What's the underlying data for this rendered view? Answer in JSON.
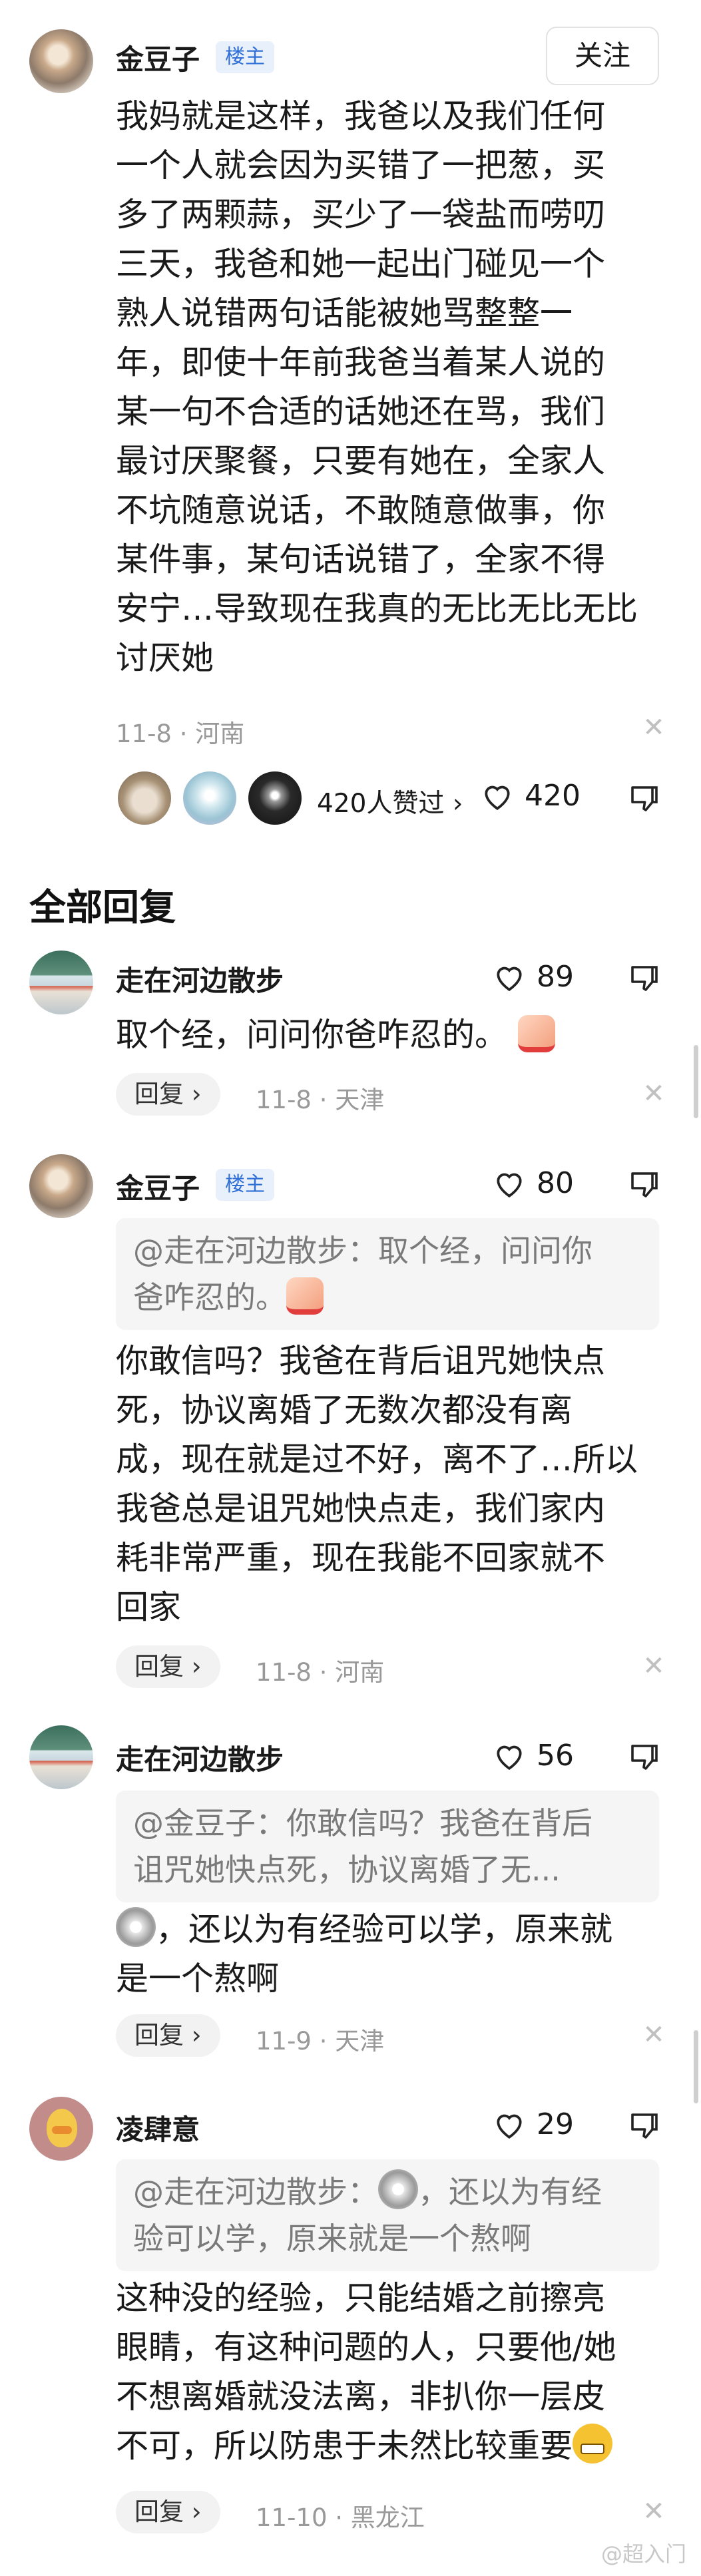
{
  "main_post": {
    "author": "金豆子",
    "badge": "楼主",
    "follow_label": "关注",
    "lines": [
      "我妈就是这样，我爸以及我们任何",
      "一个人就会因为买错了一把葱，买",
      "多了两颗蒜，买少了一袋盐而唠叨",
      "三天，我爸和她一起出门碰见一个",
      "熟人说错两句话能被她骂整整一",
      "年，即使十年前我爸当着某人说的",
      "某一句不合适的话她还在骂，我们",
      "最讨厌聚餐，只要有她在，全家人",
      "不坑随意说话，不敢随意做事，你",
      "某件事，某句话说错了，全家不得",
      "安宁…导致现在我真的无比无比无比",
      "讨厌她"
    ],
    "meta": "11-8 · 河南",
    "liked_by_text": "420人赞过",
    "like_count": "420"
  },
  "section_title": "全部回复",
  "replies": [
    {
      "author": "走在河边散步",
      "like_count": "89",
      "lines": [
        "取个经，问问你爸咋忍的。"
      ],
      "reply_label": "回复",
      "meta": "11-8 · 天津"
    },
    {
      "author": "金豆子",
      "badge": "楼主",
      "like_count": "80",
      "quote_lines": [
        "@走在河边散步：取个经，问问你",
        "爸咋忍的。"
      ],
      "lines": [
        "你敢信吗？我爸在背后诅咒她快点",
        "死，协议离婚了无数次都没有离",
        "成，现在就是过不好，离不了…所以",
        "我爸总是诅咒她快点走，我们家内",
        "耗非常严重，现在我能不回家就不",
        "回家"
      ],
      "reply_label": "回复",
      "meta": "11-8 · 河南"
    },
    {
      "author": "走在河边散步",
      "like_count": "56",
      "quote_lines": [
        "@金豆子：你敢信吗？我爸在背后",
        "诅咒她快点死，协议离婚了无..."
      ],
      "lines": [
        "，还以为有经验可以学，原来就",
        "是一个熬啊"
      ],
      "reply_label": "回复",
      "meta": "11-9 · 天津"
    },
    {
      "author": "凌肆意",
      "like_count": "29",
      "quote_lines": [
        "，还以为有经",
        "验可以学，原来就是一个熬啊"
      ],
      "quote_prefix": "@走在河边散步：",
      "lines": [
        "这种没的经验，只能结婚之前擦亮",
        "眼睛，有这种问题的人，只要他/她",
        "不想离婚就没法离，非扒你一层皮",
        "不可，所以防患于未然比较重要"
      ],
      "reply_label": "回复",
      "meta": "11-10 · 黑龙江"
    }
  ],
  "watermark": "@超入门",
  "icons": [
    "heart-icon",
    "dislike-icon",
    "close-icon",
    "chevron-right-icon"
  ]
}
